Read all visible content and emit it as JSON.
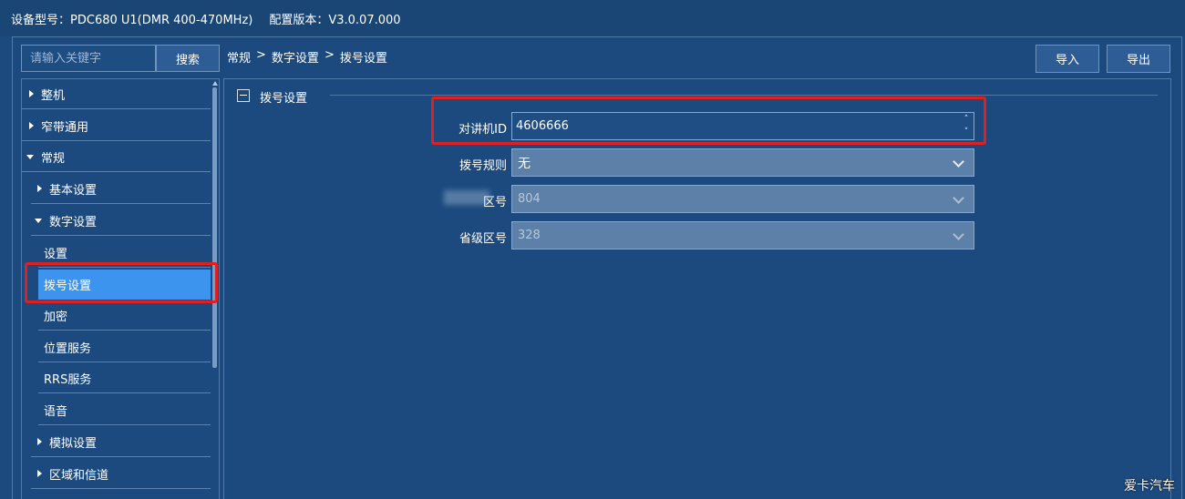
{
  "topbar": {
    "device_label": "设备型号：",
    "device_value": "PDC680 U1(DMR 400-470MHz)",
    "version_label": "配置版本：",
    "version_value": "V3.0.07.000"
  },
  "search": {
    "placeholder": "请输入关键字",
    "button_label": "搜索"
  },
  "sidebar": {
    "items": [
      {
        "label": "整机",
        "caret": "right",
        "level": 0
      },
      {
        "label": "窄带通用",
        "caret": "right",
        "level": 0
      },
      {
        "label": "常规",
        "caret": "down",
        "level": 0
      },
      {
        "label": "基本设置",
        "caret": "right",
        "level": 1
      },
      {
        "label": "数字设置",
        "caret": "down",
        "level": 1
      },
      {
        "label": "设置",
        "caret": "none",
        "level": 2
      },
      {
        "label": "拨号设置",
        "caret": "none",
        "level": 2,
        "selected": true
      },
      {
        "label": "加密",
        "caret": "none",
        "level": 2
      },
      {
        "label": "位置服务",
        "caret": "none",
        "level": 2
      },
      {
        "label": "RRS服务",
        "caret": "none",
        "level": 2
      },
      {
        "label": "语音",
        "caret": "none",
        "level": 2
      },
      {
        "label": "模拟设置",
        "caret": "right",
        "level": 1
      },
      {
        "label": "区域和信道",
        "caret": "right",
        "level": 1
      }
    ]
  },
  "breadcrumb": {
    "part1": "常规",
    "sep1": ">",
    "part2": "数字设置",
    "sep2": ">",
    "part3": "拨号设置"
  },
  "toolbar": {
    "import_label": "导入",
    "export_label": "导出"
  },
  "section": {
    "title": "拨号设置"
  },
  "fields": {
    "radio_id": {
      "label": "对讲机ID",
      "value": "4606666"
    },
    "dial_rule": {
      "label": "拨号规则",
      "value": "无"
    },
    "area_code": {
      "label": "区号",
      "value": "804"
    },
    "province_code": {
      "label": "省级区号",
      "value": "328"
    }
  },
  "icons": {
    "spin_up": "˄",
    "spin_down": "˅"
  },
  "watermark": "爱卡汽车"
}
